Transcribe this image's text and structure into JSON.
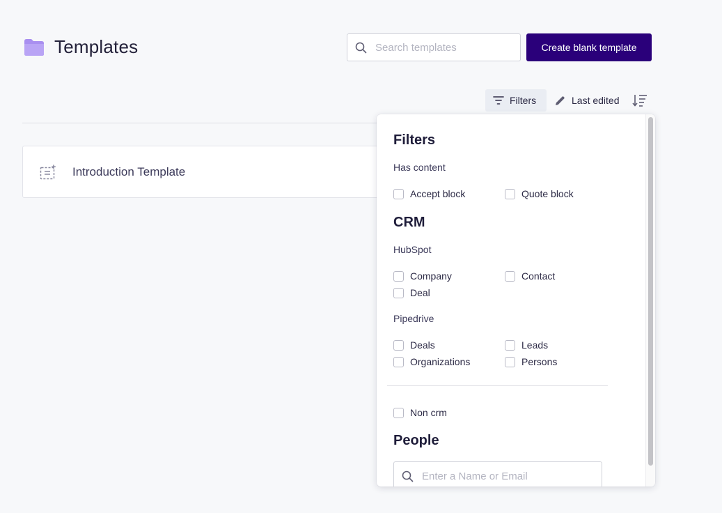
{
  "header": {
    "title": "Templates",
    "search_placeholder": "Search templates",
    "create_label": "Create blank template"
  },
  "toolbar": {
    "filters_label": "Filters",
    "sort_label": "Last edited"
  },
  "templates": [
    {
      "name": "Introduction Template"
    }
  ],
  "filters_panel": {
    "title": "Filters",
    "has_content": {
      "label": "Has content",
      "options": [
        "Accept block",
        "Quote block"
      ]
    },
    "crm": {
      "title": "CRM",
      "hubspot": {
        "label": "HubSpot",
        "options": [
          "Company",
          "Contact",
          "Deal"
        ]
      },
      "pipedrive": {
        "label": "Pipedrive",
        "options": [
          "Deals",
          "Leads",
          "Organizations",
          "Persons"
        ]
      }
    },
    "non_crm_label": "Non crm",
    "people": {
      "title": "People",
      "placeholder": "Enter a Name or Email"
    }
  },
  "colors": {
    "primary": "#2a007a",
    "folder": "#a98ff0",
    "background": "#f7f8fa"
  }
}
